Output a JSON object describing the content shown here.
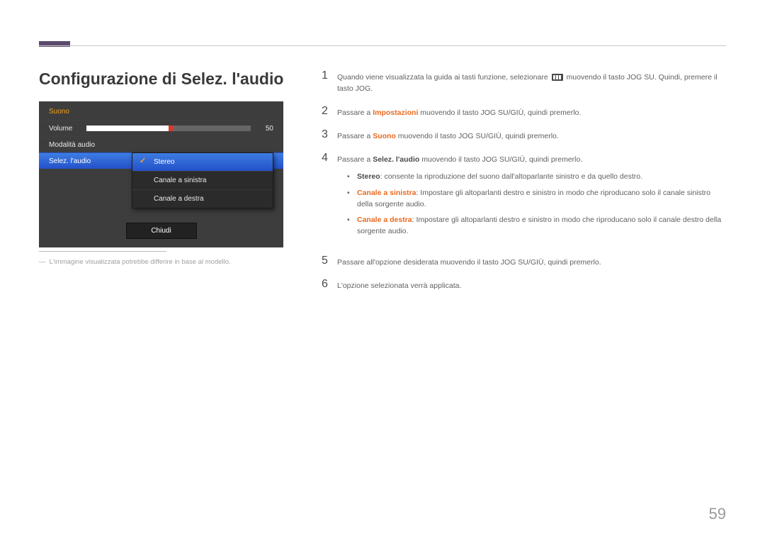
{
  "page": {
    "title": "Configurazione di Selez. l'audio",
    "number": "59"
  },
  "osd": {
    "menu_title": "Suono",
    "volume_label": "Volume",
    "volume_value": "50",
    "mode_label": "Modalità audio",
    "select_label": "Selez. l'audio",
    "submenu": {
      "opt1": "Stereo",
      "opt2": "Canale a sinistra",
      "opt3": "Canale a destra"
    },
    "close_label": "Chiudi"
  },
  "footnote": {
    "dash": "―",
    "text": "L'immagine visualizzata potrebbe differire in base al modello."
  },
  "steps": {
    "s1_a": "Quando viene visualizzata la guida ai tasti funzione, selezionare ",
    "s1_b": " muovendo il tasto JOG SU. Quindi, premere il tasto JOG.",
    "s2_a": "Passare a ",
    "s2_hl": "Impostazioni",
    "s2_b": " muovendo il tasto JOG SU/GIÙ, quindi premerlo.",
    "s3_a": "Passare a ",
    "s3_hl": "Suono",
    "s3_b": " muovendo il tasto JOG SU/GIÙ, quindi premerlo.",
    "s4_a": "Passare a ",
    "s4_hl": "Selez. l'audio",
    "s4_b": " muovendo il tasto JOG SU/GIÙ, quindi premerlo.",
    "b1_hl": "Stereo",
    "b1_t": ": consente la riproduzione del suono dall'altoparlante sinistro e da quello destro.",
    "b2_hl": "Canale a sinistra",
    "b2_t": ": Impostare gli altoparlanti destro e sinistro in modo che riproducano solo il canale sinistro della sorgente audio.",
    "b3_hl": "Canale a destra",
    "b3_t": ": Impostare gli altoparlanti destro e sinistro in modo che riproducano solo il canale destro della sorgente audio.",
    "s5": "Passare all'opzione desiderata muovendo il tasto JOG SU/GIÙ, quindi premerlo.",
    "s6": "L'opzione selezionata verrà applicata."
  }
}
